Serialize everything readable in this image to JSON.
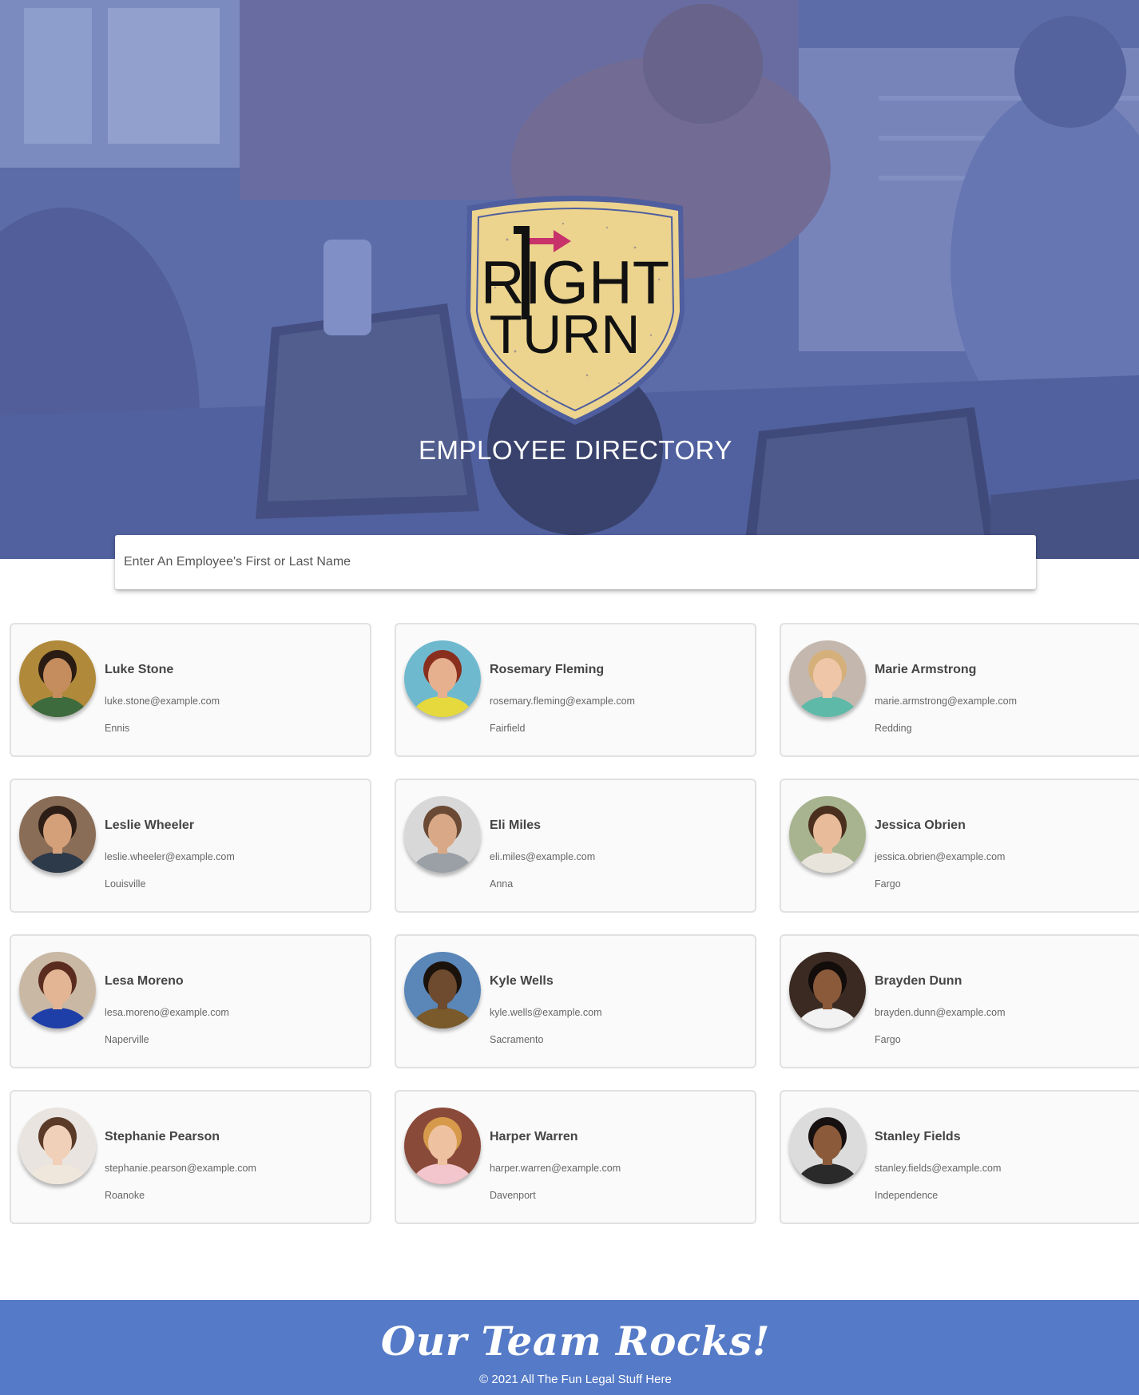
{
  "header": {
    "title": "EMPLOYEE DIRECTORY",
    "logo_line1": "RIGHT",
    "logo_line2": "TURN",
    "logo_colors": {
      "shield": "#ecd48e",
      "border": "#4f5e9e",
      "text": "#111111",
      "arrow": "#c8326b"
    }
  },
  "search": {
    "placeholder": "Enter An Employee's First or Last Name",
    "value": ""
  },
  "employees": [
    {
      "name": "Luke Stone",
      "email": "luke.stone@example.com",
      "city": "Ennis",
      "bg": "#b08a3a",
      "skin": "#c58c5e",
      "hair": "#2a1c12",
      "shirt": "#3e6b3e"
    },
    {
      "name": "Rosemary Fleming",
      "email": "rosemary.fleming@example.com",
      "city": "Fairfield",
      "bg": "#6fb9cf",
      "skin": "#e6b08e",
      "hair": "#8a2f1e",
      "shirt": "#e5d93e"
    },
    {
      "name": "Marie Armstrong",
      "email": "marie.armstrong@example.com",
      "city": "Redding",
      "bg": "#c4b7ae",
      "skin": "#efc6a8",
      "hair": "#d6b07a",
      "shirt": "#5fb9a8"
    },
    {
      "name": "Leslie Wheeler",
      "email": "leslie.wheeler@example.com",
      "city": "Louisville",
      "bg": "#8a6d57",
      "skin": "#d4a07a",
      "hair": "#2c1e16",
      "shirt": "#2c3a4a"
    },
    {
      "name": "Eli Miles",
      "email": "eli.miles@example.com",
      "city": "Anna",
      "bg": "#d8d8d8",
      "skin": "#d9a987",
      "hair": "#6b4a35",
      "shirt": "#9aa0a6"
    },
    {
      "name": "Jessica Obrien",
      "email": "jessica.obrien@example.com",
      "city": "Fargo",
      "bg": "#a7b48f",
      "skin": "#e8bc9a",
      "hair": "#4a2f1f",
      "shirt": "#e8e4dc"
    },
    {
      "name": "Lesa Moreno",
      "email": "lesa.moreno@example.com",
      "city": "Naperville",
      "bg": "#c9b8a4",
      "skin": "#e4b594",
      "hair": "#5a2c1f",
      "shirt": "#1f3fa8"
    },
    {
      "name": "Kyle Wells",
      "email": "kyle.wells@example.com",
      "city": "Sacramento",
      "bg": "#5a86b8",
      "skin": "#6e4a2e",
      "hair": "#1c120c",
      "shirt": "#7a5a2a"
    },
    {
      "name": "Brayden Dunn",
      "email": "brayden.dunn@example.com",
      "city": "Fargo",
      "bg": "#3a2a22",
      "skin": "#8a5a3a",
      "hair": "#120c0a",
      "shirt": "#f2f2f2"
    },
    {
      "name": "Stephanie Pearson",
      "email": "stephanie.pearson@example.com",
      "city": "Roanoke",
      "bg": "#e9e4df",
      "skin": "#f0d0b8",
      "hair": "#5a3a28",
      "shirt": "#efe6dc"
    },
    {
      "name": "Harper Warren",
      "email": "harper.warren@example.com",
      "city": "Davenport",
      "bg": "#8a4a3a",
      "skin": "#eec1a0",
      "hair": "#d69a4a",
      "shirt": "#f2c6cc"
    },
    {
      "name": "Stanley Fields",
      "email": "stanley.fields@example.com",
      "city": "Independence",
      "bg": "#dcdcdc",
      "skin": "#8a5a3a",
      "hair": "#161010",
      "shirt": "#2a2a2a"
    }
  ],
  "footer": {
    "title": "Our Team Rocks!",
    "copyright": "© 2021 All The Fun Legal Stuff Here"
  }
}
